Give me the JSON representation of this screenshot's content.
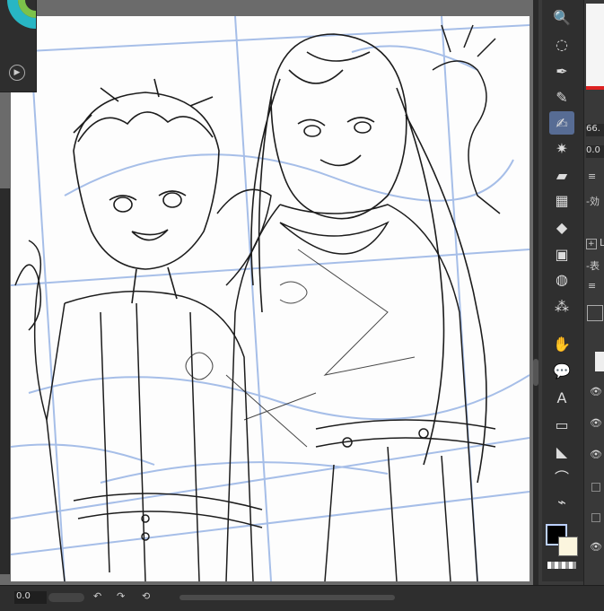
{
  "colors": {
    "canvas_bg": "#fdfdfd",
    "blue_line": "#9db8e6",
    "ink": "#1c1c1c",
    "accent": "#576c94"
  },
  "toolbar": {
    "tools": [
      {
        "name": "zoom-tool",
        "icon": "🔍"
      },
      {
        "name": "lasso-select-tool",
        "icon": "◌"
      },
      {
        "name": "pen-tool",
        "icon": "✒"
      },
      {
        "name": "pencil-tool",
        "icon": "✎"
      },
      {
        "name": "pen-active-tool",
        "icon": "✍"
      },
      {
        "name": "magic-wand-tool",
        "icon": "✷"
      },
      {
        "name": "eraser-tool",
        "icon": "▰"
      },
      {
        "name": "blend-tool",
        "icon": "▦"
      },
      {
        "name": "fill-tool",
        "icon": "◆"
      },
      {
        "name": "gradient-tool",
        "icon": "▣"
      },
      {
        "name": "water-tool",
        "icon": "◍"
      },
      {
        "name": "spray-tool",
        "icon": "⁂"
      },
      {
        "name": "hand-tool",
        "icon": "✋"
      },
      {
        "name": "speech-balloon-tool",
        "icon": "💬"
      },
      {
        "name": "text-tool",
        "icon": "A"
      },
      {
        "name": "frame-tool",
        "icon": "▭"
      },
      {
        "name": "ruler-tool",
        "icon": "◣"
      },
      {
        "name": "correct-line-tool",
        "icon": "⌒"
      },
      {
        "name": "eyedropper-tool",
        "icon": "⌁"
      }
    ]
  },
  "right_panel": {
    "zoom_value": "66.",
    "angle_value": "0.0",
    "label_effect": "-効",
    "label_layer": "L",
    "label_display": "-表"
  },
  "bottom_bar": {
    "value": "0.0"
  }
}
